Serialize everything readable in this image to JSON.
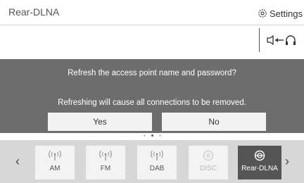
{
  "header": {
    "title": "Rear-DLNA",
    "settings_label": "Settings"
  },
  "output": {
    "icon": "speaker-to-headphones-icon"
  },
  "dialog": {
    "message": "Refresh the access point name and password?",
    "detail": "Refreshing will cause all connections to be removed.",
    "yes_label": "Yes",
    "no_label": "No"
  },
  "pager": {
    "count": 3,
    "active_index": 1
  },
  "sources": {
    "items": [
      {
        "label": "AM",
        "icon": "antenna-icon",
        "state": "enabled"
      },
      {
        "label": "FM",
        "icon": "antenna-icon",
        "state": "enabled"
      },
      {
        "label": "DAB",
        "icon": "antenna-icon",
        "state": "enabled"
      },
      {
        "label": "DISC",
        "icon": "disc-icon",
        "state": "disabled"
      },
      {
        "label": "Rear-DLNA",
        "icon": "dlna-icon",
        "state": "selected"
      }
    ]
  },
  "colors": {
    "dialog_bg": "#6d6d6d",
    "source_bar_bg": "#d7d7d7",
    "selected_source_bg": "#555555"
  }
}
